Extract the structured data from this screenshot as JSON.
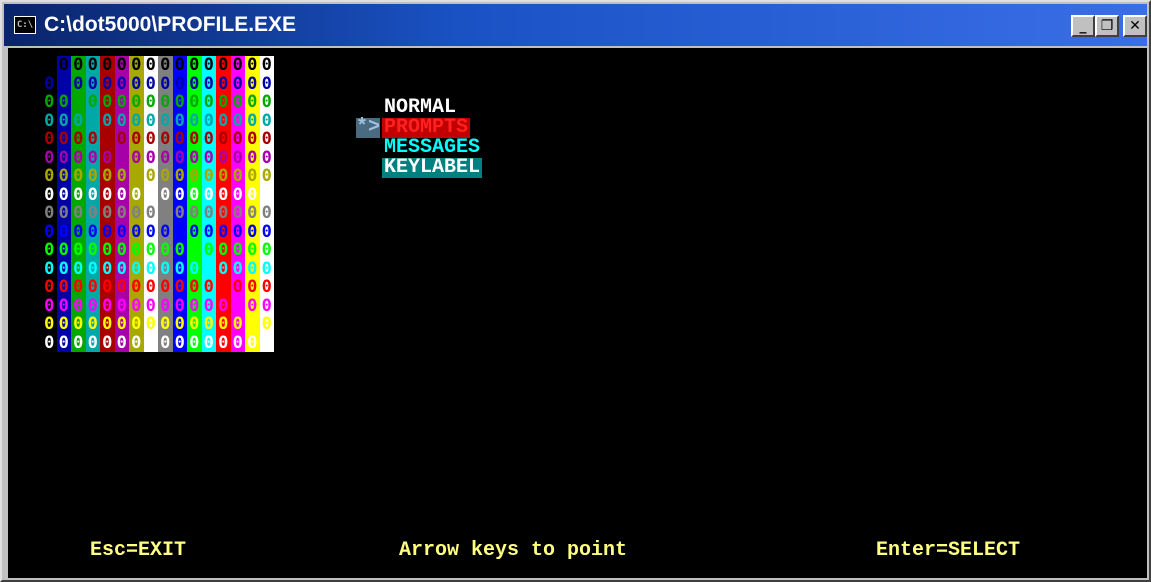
{
  "window": {
    "title": "C:\\dot5000\\PROFILE.EXE",
    "icon_label": "C:\\",
    "controls": {
      "minimize": "_",
      "maximize": "❐",
      "close": "✕"
    }
  },
  "palette": {
    "glyph": "0",
    "colors": [
      "#000000",
      "#0000a8",
      "#00a800",
      "#00a8a8",
      "#a80000",
      "#a800a8",
      "#a8a800",
      "#ffffff",
      "#808080",
      "#0000ff",
      "#00ff00",
      "#00ffff",
      "#ff0000",
      "#ff00ff",
      "#ffff00",
      "#ffffff"
    ]
  },
  "menu": {
    "pointer": "*>",
    "items": [
      {
        "label": "NORMAL"
      },
      {
        "label": "PROMPTS"
      },
      {
        "label": "MESSAGES"
      },
      {
        "label": "KEYLABEL"
      }
    ]
  },
  "status": {
    "exit": "Esc=EXIT",
    "point": "Arrow keys to point",
    "select": "Enter=SELECT"
  }
}
